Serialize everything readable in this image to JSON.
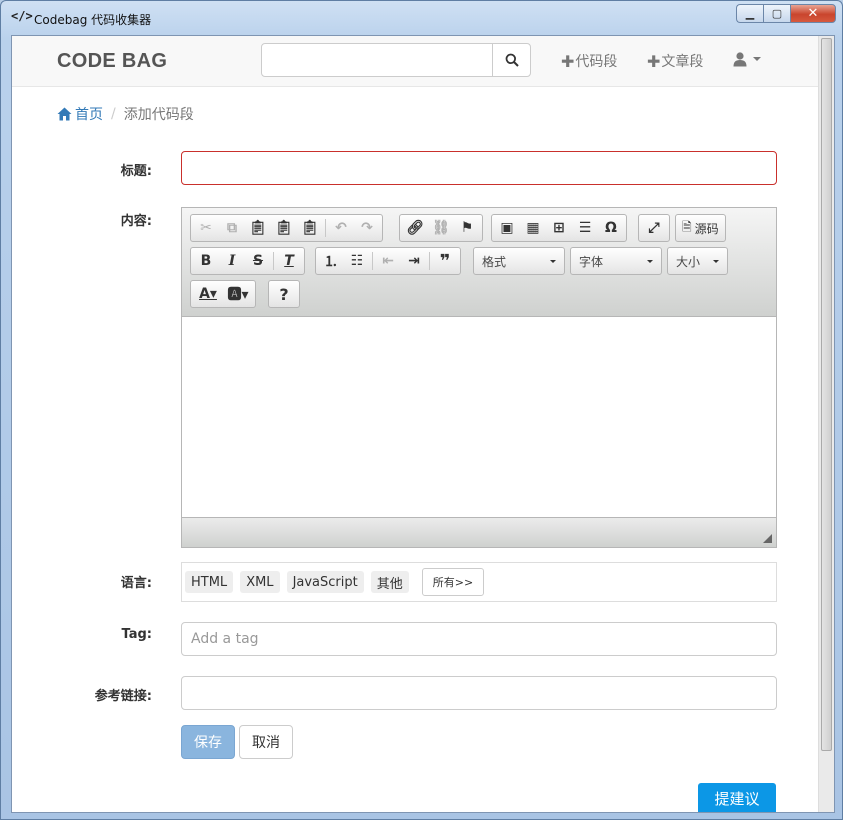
{
  "window": {
    "icon": "</>",
    "title": "Codebag 代码收集器",
    "controls": {
      "minimize": "▁",
      "maximize": "▢",
      "close": "✕"
    }
  },
  "navbar": {
    "brand": "CODE BAG",
    "search": {
      "value": "",
      "placeholder": ""
    },
    "links": [
      {
        "label": "代码段"
      },
      {
        "label": "文章段"
      }
    ],
    "plus_glyph": "✚"
  },
  "breadcrumb": {
    "home": "首页",
    "separator": "/",
    "current": "添加代码段"
  },
  "form": {
    "title_label": "标题:",
    "content_label": "内容:",
    "language_label": "语言:",
    "tag_label": "Tag:",
    "tag_placeholder": "Add a tag",
    "ref_label": "参考链接:",
    "ref_value": ""
  },
  "editor": {
    "source_label": "源码",
    "format_combo": "格式",
    "font_combo": "字体",
    "size_combo": "大小"
  },
  "languages": [
    "HTML",
    "XML",
    "JavaScript",
    "其他"
  ],
  "languages_more": "所有>>",
  "buttons": {
    "save": "保存",
    "cancel": "取消",
    "suggest": "提建议"
  }
}
